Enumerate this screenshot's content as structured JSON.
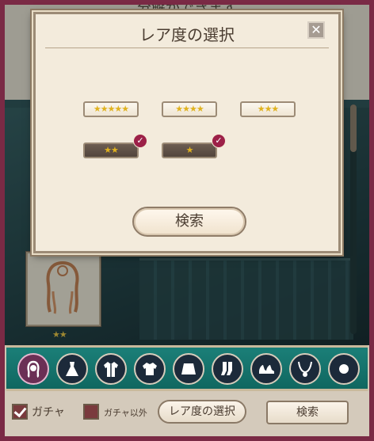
{
  "background": {
    "top_message": "分解ができます"
  },
  "card": {
    "rarity_stars": "★★"
  },
  "dialog": {
    "title": "レア度の選択",
    "close_label": "✕",
    "rarities": [
      {
        "stars": "★★★★★",
        "selected": false
      },
      {
        "stars": "★★★★",
        "selected": false
      },
      {
        "stars": "★★★",
        "selected": false
      },
      {
        "stars": "★★",
        "selected": true
      },
      {
        "stars": "★",
        "selected": true
      }
    ],
    "check_mark": "✓",
    "search_label": "検索"
  },
  "categories": [
    {
      "icon": "hair-icon",
      "selected": true
    },
    {
      "icon": "dress-icon",
      "selected": false
    },
    {
      "icon": "coat-icon",
      "selected": false
    },
    {
      "icon": "top-icon",
      "selected": false
    },
    {
      "icon": "bottom-icon",
      "selected": false
    },
    {
      "icon": "socks-icon",
      "selected": false
    },
    {
      "icon": "shoes-icon",
      "selected": false
    },
    {
      "icon": "necklace-icon",
      "selected": false
    },
    {
      "icon": "accessory-icon",
      "selected": false
    }
  ],
  "filters": {
    "gacha_label": "ガチャ",
    "gacha_checked": true,
    "non_gacha_label": "ガチャ以外",
    "non_gacha_checked": false,
    "rarity_select_label": "レア度の選択",
    "search_label": "検索"
  },
  "colors": {
    "accent": "#9c2048",
    "teal_bar": "#1b7f78",
    "star": "#e0b21f"
  }
}
